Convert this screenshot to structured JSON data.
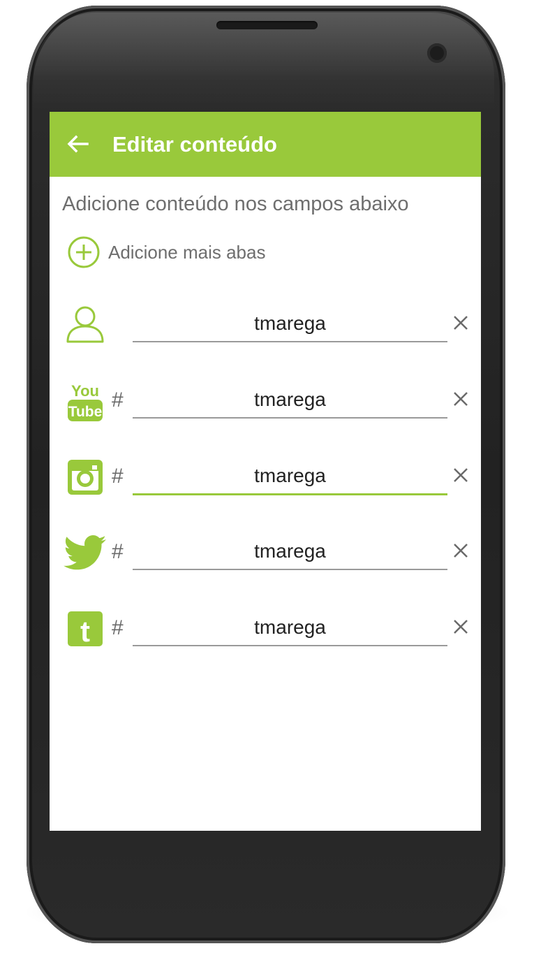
{
  "colors": {
    "accent": "#99c93b",
    "text_secondary": "#6e6e6e",
    "icon_gray": "#6a6a6a"
  },
  "appbar": {
    "back_icon": "arrow-back-icon",
    "title": "Editar conteúdo"
  },
  "subtitle": "Adicione conteúdo nos campos abaixo",
  "add_tabs": {
    "icon": "add-circle-icon",
    "label": "Adicione mais abas"
  },
  "fields": [
    {
      "icon": "user-icon",
      "prefix": "",
      "value": "tmarega",
      "clear_icon": "close-icon"
    },
    {
      "icon": "youtube-icon",
      "prefix": "#",
      "value": "tmarega",
      "clear_icon": "close-icon"
    },
    {
      "icon": "instagram-icon",
      "prefix": "#",
      "value": "tmarega",
      "clear_icon": "close-icon",
      "focused": true
    },
    {
      "icon": "twitter-icon",
      "prefix": "#",
      "value": "tmarega",
      "clear_icon": "close-icon"
    },
    {
      "icon": "tumblr-icon",
      "prefix": "#",
      "value": "tmarega",
      "clear_icon": "close-icon"
    }
  ],
  "icon_text": {
    "youtube_top": "You",
    "youtube_bottom": "Tube",
    "tumblr": "t"
  }
}
